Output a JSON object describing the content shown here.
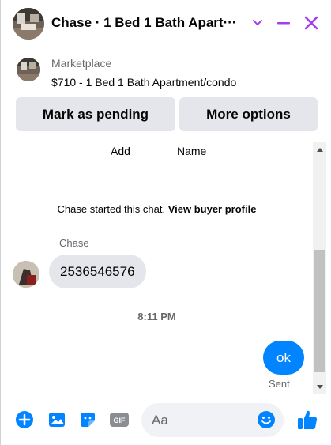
{
  "header": {
    "title": "Chase · 1 Bed 1 Bath Apart···",
    "avatar_icon": "listing-photo",
    "accent": "#a33cf3"
  },
  "marketplace": {
    "label": "Marketplace",
    "listing": "$710 - 1 Bed 1 Bath Apartment/condo",
    "mark_pending": "Mark as pending",
    "more_options": "More options"
  },
  "messages": {
    "add_label": "Add",
    "name_label": "Name",
    "started_text": "Chase started this chat.",
    "view_profile": "View buyer profile",
    "sender": "Chase",
    "incoming": "2536546576",
    "timestamp": "8:11 PM",
    "outgoing": "ok",
    "status": "Sent"
  },
  "composer": {
    "placeholder": "Aa",
    "gif_label": "GIF",
    "accent": "#0084ff"
  },
  "colors": {
    "messenger_blue": "#0084ff",
    "header_purple": "#a33cf3",
    "button_gray": "#e4e6eb"
  }
}
